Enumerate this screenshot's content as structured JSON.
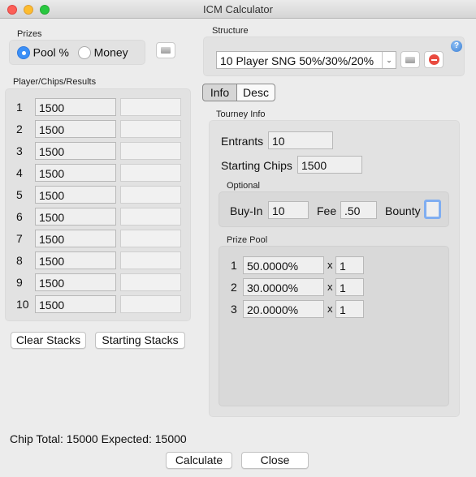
{
  "window": {
    "title": "ICM Calculator"
  },
  "prizes": {
    "label": "Prizes",
    "options": [
      {
        "label": "Pool %",
        "selected": true
      },
      {
        "label": "Money",
        "selected": false
      }
    ],
    "icon": "list-icon"
  },
  "players": {
    "label": "Player/Chips/Results",
    "rows": [
      {
        "num": "1",
        "chips": "1500",
        "result": ""
      },
      {
        "num": "2",
        "chips": "1500",
        "result": ""
      },
      {
        "num": "3",
        "chips": "1500",
        "result": ""
      },
      {
        "num": "4",
        "chips": "1500",
        "result": ""
      },
      {
        "num": "5",
        "chips": "1500",
        "result": ""
      },
      {
        "num": "6",
        "chips": "1500",
        "result": ""
      },
      {
        "num": "7",
        "chips": "1500",
        "result": ""
      },
      {
        "num": "8",
        "chips": "1500",
        "result": ""
      },
      {
        "num": "9",
        "chips": "1500",
        "result": ""
      },
      {
        "num": "10",
        "chips": "1500",
        "result": ""
      }
    ],
    "clear_button": "Clear Stacks",
    "starting_button": "Starting Stacks"
  },
  "structure": {
    "label": "Structure",
    "selected": "10 Player SNG 50%/30%/20%",
    "help_icon": "help-icon",
    "list_icon": "list-icon",
    "delete_icon": "delete-icon"
  },
  "tabs": [
    {
      "label": "Info",
      "active": true
    },
    {
      "label": "Desc",
      "active": false
    }
  ],
  "tourney": {
    "label": "Tourney Info",
    "entrants_label": "Entrants",
    "entrants": "10",
    "starting_chips_label": "Starting Chips",
    "starting_chips": "1500",
    "optional": {
      "label": "Optional",
      "buyin_label": "Buy-In",
      "buyin": "10",
      "fee_label": "Fee",
      "fee": ".50",
      "bounty_label": "Bounty",
      "bounty": false
    },
    "prize_pool": {
      "label": "Prize Pool",
      "rows": [
        {
          "num": "1",
          "pct": "50.0000%",
          "x": "x",
          "mult": "1"
        },
        {
          "num": "2",
          "pct": "30.0000%",
          "x": "x",
          "mult": "1"
        },
        {
          "num": "3",
          "pct": "20.0000%",
          "x": "x",
          "mult": "1"
        }
      ]
    }
  },
  "footer": {
    "status": "Chip Total: 15000 Expected: 15000",
    "calculate": "Calculate",
    "close": "Close"
  }
}
